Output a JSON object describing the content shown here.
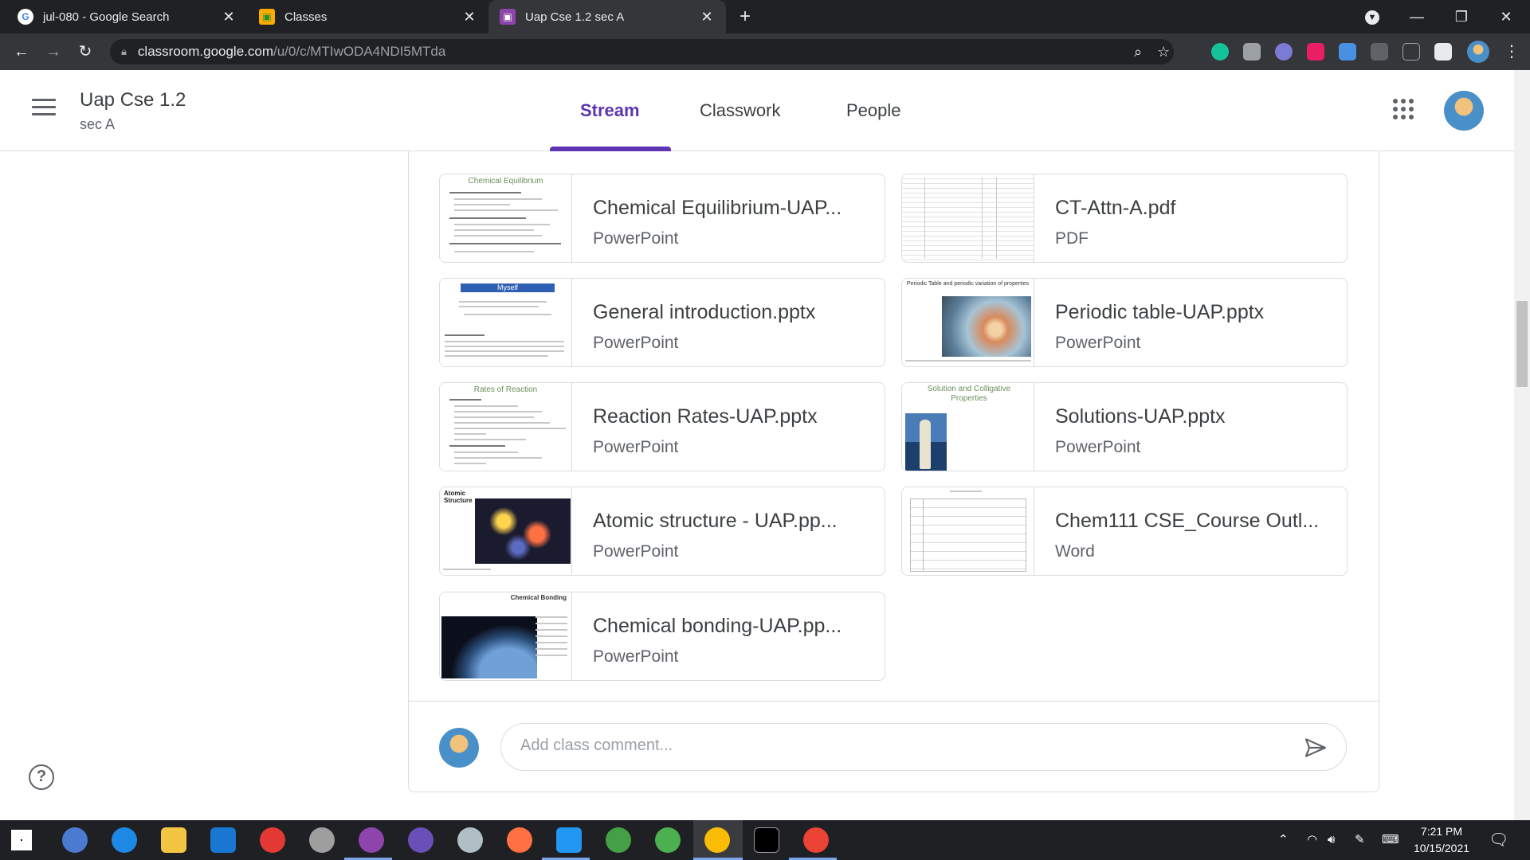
{
  "browser": {
    "tabs": [
      {
        "title": "jul-080 - Google Search",
        "favicon": "google-g-icon"
      },
      {
        "title": "Classes",
        "favicon": "classroom-icon"
      },
      {
        "title": "Uap Cse 1.2 sec A",
        "favicon": "classroom-icon",
        "active": true
      }
    ],
    "url_host": "classroom.google.com",
    "url_path": "/u/0/c/MTIwODA4NDI5MTda"
  },
  "header": {
    "class_name": "Uap Cse 1.2",
    "section": "sec A",
    "tabs": [
      "Stream",
      "Classwork",
      "People"
    ],
    "active_tab": "Stream"
  },
  "attachments": [
    {
      "name": "Chemical Equilibrium-UAP...",
      "kind": "PowerPoint",
      "thumb_title": "Chemical Equilibrium"
    },
    {
      "name": "CT-Attn-A.pdf",
      "kind": "PDF",
      "thumb_title": ""
    },
    {
      "name": "General introduction.pptx",
      "kind": "PowerPoint",
      "thumb_title": "Myself"
    },
    {
      "name": "Periodic table-UAP.pptx",
      "kind": "PowerPoint",
      "thumb_title": "Periodic Table and periodic variation of properties"
    },
    {
      "name": "Reaction Rates-UAP.pptx",
      "kind": "PowerPoint",
      "thumb_title": "Rates of Reaction"
    },
    {
      "name": "Solutions-UAP.pptx",
      "kind": "PowerPoint",
      "thumb_title": "Solution and Colligative Properties"
    },
    {
      "name": "Atomic structure - UAP.pp...",
      "kind": "PowerPoint",
      "thumb_title": "Atomic Structure"
    },
    {
      "name": "Chem111 CSE_Course Outl...",
      "kind": "Word",
      "thumb_title": ""
    },
    {
      "name": "Chemical bonding-UAP.pp...",
      "kind": "PowerPoint",
      "thumb_title": "Chemical Bonding"
    }
  ],
  "comment": {
    "placeholder": "Add class comment..."
  },
  "taskbar": {
    "time": "7:21 PM",
    "date": "10/15/2021"
  },
  "colors": {
    "accent": "#5e35b1",
    "chrome_dark": "#202124",
    "chrome_mid": "#35363a"
  }
}
